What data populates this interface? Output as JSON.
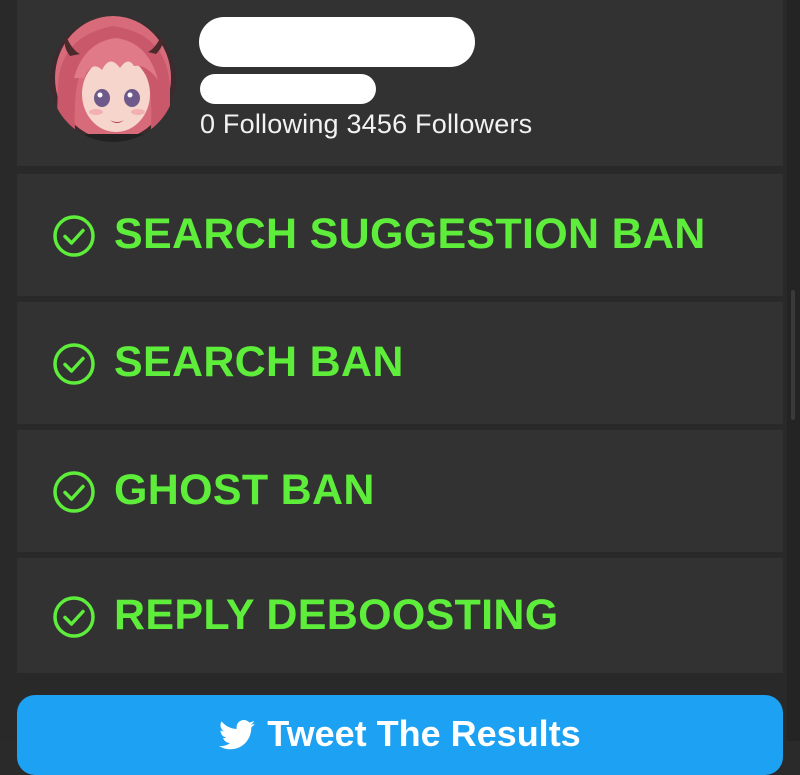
{
  "profile": {
    "handle_prefix": "@",
    "stats": "0 Following 3456 Followers",
    "avatar_icon": "anime-avatar-icon"
  },
  "checks": [
    {
      "label": "SEARCH SUGGESTION BAN",
      "icon": "check-circle-icon",
      "status": "passed"
    },
    {
      "label": "SEARCH BAN",
      "icon": "check-circle-icon",
      "status": "passed"
    },
    {
      "label": "GHOST BAN",
      "icon": "check-circle-icon",
      "status": "passed"
    },
    {
      "label": "REPLY DEBOOSTING",
      "icon": "check-circle-icon",
      "status": "passed"
    }
  ],
  "tweet_button": {
    "label": "Tweet The Results",
    "icon": "twitter-bird-icon"
  },
  "colors": {
    "background": "#292929",
    "card": "#323232",
    "check_green": "#5ded3a",
    "tweet_blue": "#1da1f2"
  }
}
